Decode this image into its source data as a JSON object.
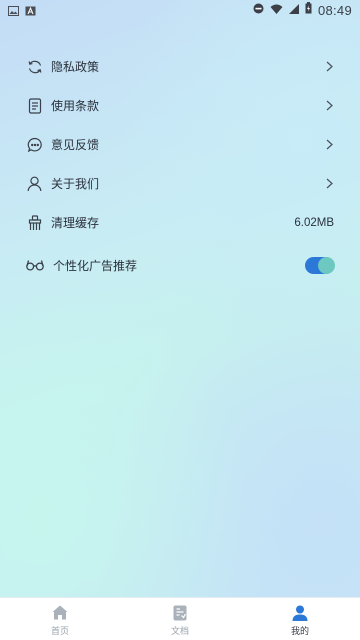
{
  "status_bar": {
    "time": "08:49",
    "left_icons": [
      "image-icon",
      "font-icon"
    ],
    "right_icons": [
      "dnd-icon",
      "wifi-icon",
      "signal-icon",
      "battery-icon"
    ]
  },
  "settings": {
    "items": [
      {
        "label": "隐私政策",
        "icon": "sync-icon"
      },
      {
        "label": "使用条款",
        "icon": "document-icon"
      },
      {
        "label": "意见反馈",
        "icon": "chat-icon"
      },
      {
        "label": "关于我们",
        "icon": "person-icon"
      },
      {
        "label": "清理缓存",
        "icon": "clean-icon",
        "value": "6.02MB"
      },
      {
        "label": "个性化广告推荐",
        "icon": "glasses-icon",
        "toggle_on": true
      }
    ]
  },
  "bottom_nav": {
    "items": [
      {
        "label": "首页",
        "icon": "home-icon"
      },
      {
        "label": "文档",
        "icon": "document-nav-icon"
      },
      {
        "label": "我的",
        "icon": "profile-icon",
        "active": true
      }
    ]
  },
  "colors": {
    "accent": "#2c78d9",
    "toggle_knob": "#6cc8c0",
    "nav_inactive": "#9aa3ad"
  }
}
